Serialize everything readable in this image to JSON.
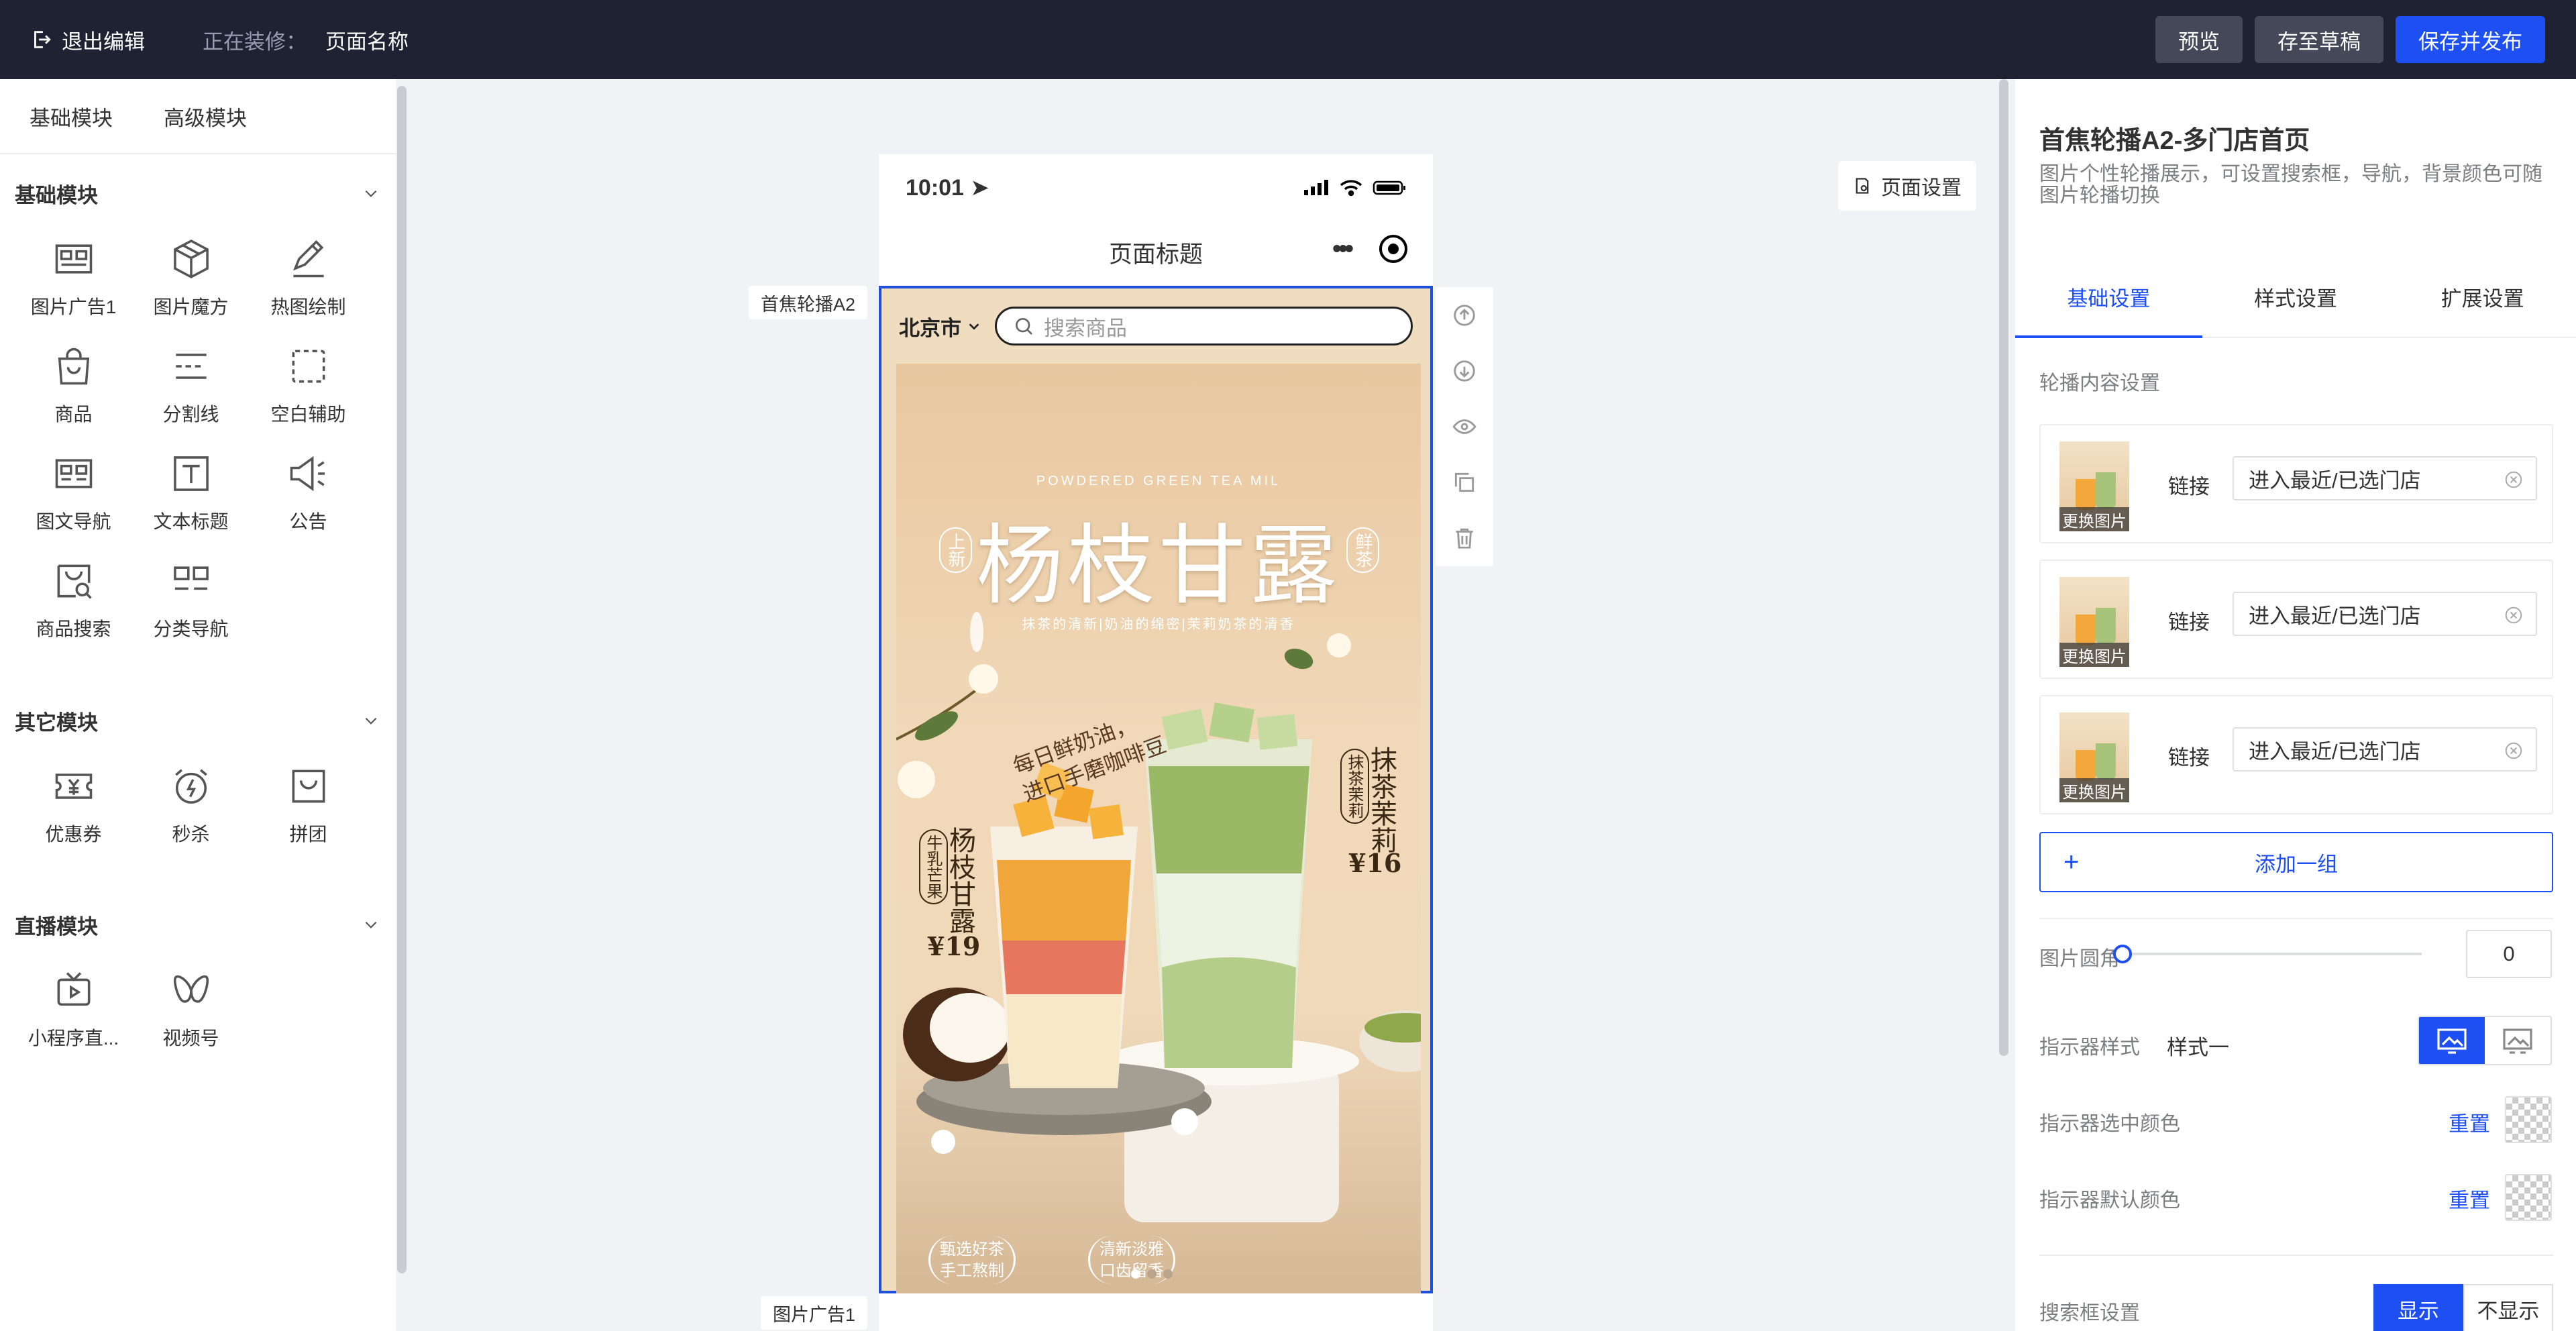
{
  "topbar": {
    "exit_label": "退出编辑",
    "editing_label": "正在装修：",
    "page_name": "页面名称",
    "buttons": {
      "preview": "预览",
      "draft": "存至草稿",
      "publish": "保存并发布"
    }
  },
  "left": {
    "tabs": [
      "基础模块",
      "高级模块"
    ],
    "sections": [
      {
        "title": "基础模块",
        "items": [
          {
            "label": "图片广告1",
            "icon": "image-ad-icon"
          },
          {
            "label": "图片魔方",
            "icon": "cube-icon"
          },
          {
            "label": "热图绘制",
            "icon": "pen-icon"
          },
          {
            "label": "商品",
            "icon": "bag-icon"
          },
          {
            "label": "分割线",
            "icon": "divider-icon"
          },
          {
            "label": "空白辅助",
            "icon": "dashed-box-icon"
          },
          {
            "label": "图文导航",
            "icon": "image-nav-icon"
          },
          {
            "label": "文本标题",
            "icon": "text-icon"
          },
          {
            "label": "公告",
            "icon": "megaphone-icon"
          },
          {
            "label": "商品搜索",
            "icon": "product-search-icon"
          },
          {
            "label": "分类导航",
            "icon": "category-icon"
          }
        ]
      },
      {
        "title": "其它模块",
        "items": [
          {
            "label": "优惠券",
            "icon": "coupon-icon"
          },
          {
            "label": "秒杀",
            "icon": "alarm-icon"
          },
          {
            "label": "拼团",
            "icon": "group-icon"
          }
        ]
      },
      {
        "title": "直播模块",
        "items": [
          {
            "label": "小程序直...",
            "icon": "live-tv-icon"
          },
          {
            "label": "视频号",
            "icon": "butterfly-icon"
          }
        ]
      }
    ]
  },
  "canvas": {
    "label_banner": "首焦轮播A2",
    "label_img": "图片广告1",
    "page_settings": "页面设置",
    "phone": {
      "time": "10:01",
      "title": "页面标题",
      "city": "北京市",
      "search_placeholder": "搜索商品"
    },
    "poster": {
      "en": "POWDERED GREEN TEA MIL",
      "title": "杨枝甘露",
      "tag_left": "上新",
      "tag_right": "鲜茶",
      "subtitle": "抹茶的清新|奶油的绵密|茉莉奶茶的清香",
      "handwriting": [
        "每日鲜奶油，",
        "进口手磨咖啡豆"
      ],
      "left_name": "杨枝甘露",
      "left_tag": "牛乳芒果",
      "left_price": "¥19",
      "right_name": "抹茶茉莉",
      "right_tag": "抹茶茉莉",
      "right_price": "¥16",
      "badges": [
        [
          "甄选好茶",
          "手工熬制"
        ],
        [
          "清新淡雅",
          "口齿留香"
        ]
      ]
    }
  },
  "right": {
    "title": "首焦轮播A2-多门店首页",
    "desc": "图片个性轮播展示，可设置搜索框，导航，背景颜色可随图片轮播切换",
    "tabs": [
      "基础设置",
      "样式设置",
      "扩展设置"
    ],
    "content_label": "轮播内容设置",
    "items": [
      {
        "change": "更换图片",
        "link_label": "链接",
        "link_value": "进入最近/已选门店"
      },
      {
        "change": "更换图片",
        "link_label": "链接",
        "link_value": "进入最近/已选门店"
      },
      {
        "change": "更换图片",
        "link_label": "链接",
        "link_value": "进入最近/已选门店"
      }
    ],
    "add_label": "添加一组",
    "radius_label": "图片圆角",
    "radius_value": "0",
    "indicator_label": "指示器样式",
    "indicator_value": "样式一",
    "ind_selected_label": "指示器选中颜色",
    "ind_default_label": "指示器默认颜色",
    "reset_label": "重置",
    "searchbox_label": "搜索框设置",
    "show_label": "显示",
    "hide_label": "不显示"
  },
  "colors": {
    "accent": "#1d4ff2",
    "topbar": "#1f2233"
  }
}
